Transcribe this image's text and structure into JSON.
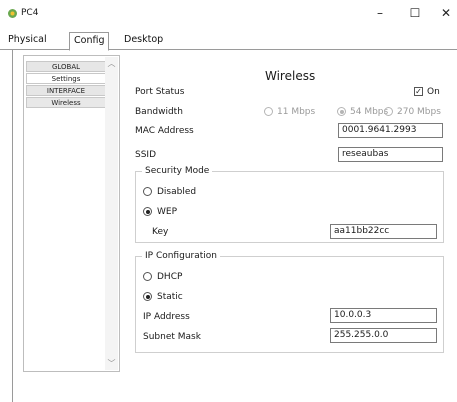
{
  "window": {
    "title": "PC4",
    "minimize": "–",
    "maximize": "☐",
    "close": "✕"
  },
  "tabs": [
    "Physical",
    "Config",
    "Desktop"
  ],
  "sidebar": {
    "items": [
      {
        "label": "GLOBAL"
      },
      {
        "label": "Settings"
      },
      {
        "label": "INTERFACE"
      },
      {
        "label": "Wireless"
      }
    ]
  },
  "panel": {
    "title": "Wireless",
    "port_status": {
      "label": "Port Status",
      "value": "On",
      "checked": true
    },
    "bandwidth": {
      "label": "Bandwidth",
      "options": [
        "11 Mbps",
        "54 Mbps",
        "270 Mbps"
      ],
      "selected": "54 Mbps"
    },
    "mac": {
      "label": "MAC Address",
      "value": "0001.9641.2993"
    },
    "ssid": {
      "label": "SSID",
      "value": "reseaubas"
    },
    "security": {
      "legend": "Security Mode",
      "options": [
        "Disabled",
        "WEP"
      ],
      "selected": "WEP",
      "key": {
        "label": "Key",
        "value": "aa11bb22cc"
      }
    },
    "ip": {
      "legend": "IP Configuration",
      "options": [
        "DHCP",
        "Static"
      ],
      "selected": "Static",
      "address": {
        "label": "IP Address",
        "value": "10.0.0.3"
      },
      "mask": {
        "label": "Subnet Mask",
        "value": "255.255.0.0"
      }
    }
  },
  "colors": {
    "border": "#9a9a9a",
    "field_border": "#7a7a7a",
    "disabled": "#9a9a9a",
    "app_icon": "#6aa84f"
  }
}
